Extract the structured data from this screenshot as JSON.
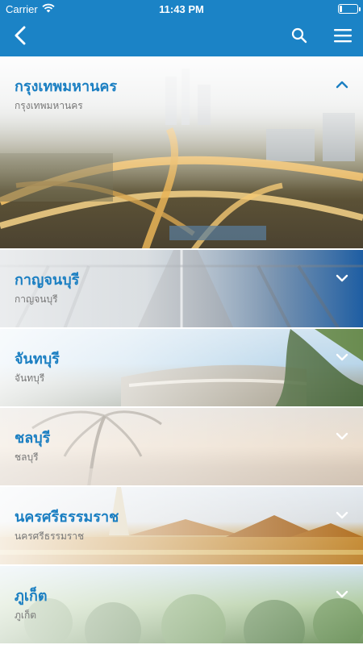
{
  "status_bar": {
    "carrier": "Carrier",
    "time": "11:43 PM",
    "battery_level": 0.15
  },
  "nav": {
    "back_icon": "chevron-left-icon",
    "search_icon": "search-icon",
    "menu_icon": "hamburger-menu-icon",
    "accent_color": "#1b83c6"
  },
  "provinces": [
    {
      "title": "กรุงเทพมหานคร",
      "subtitle": "กรุงเทพมหานคร",
      "expanded": true
    },
    {
      "title": "กาญจนบุรี",
      "subtitle": "กาญจนบุรี",
      "expanded": false
    },
    {
      "title": "จันทบุรี",
      "subtitle": "จันทบุรี",
      "expanded": false
    },
    {
      "title": "ชลบุรี",
      "subtitle": "ชลบุรี",
      "expanded": false
    },
    {
      "title": "นครศรีธรรมราช",
      "subtitle": "นครศรีธรรมราช",
      "expanded": false
    },
    {
      "title": "ภูเก็ต",
      "subtitle": "ภูเก็ต",
      "expanded": false
    }
  ]
}
